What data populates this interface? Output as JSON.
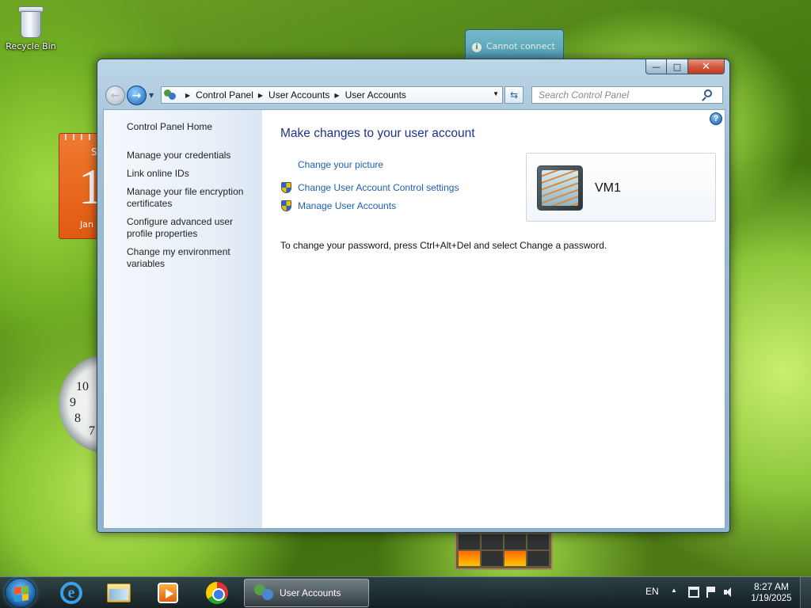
{
  "desktop": {
    "recycle_bin_label": "Recycle Bin",
    "calendar_gadget": {
      "day_abbrev": "S",
      "date_num": "1",
      "month_abbrev": "Jan"
    },
    "clock_gadget": {
      "numerals": [
        "10",
        "9",
        "8",
        "7"
      ]
    },
    "notification": "Cannot connect"
  },
  "window": {
    "controls": {
      "minimize": "—",
      "maximize": "□",
      "close": "✕"
    },
    "address": {
      "crumbs": [
        "Control Panel",
        "User Accounts",
        "User Accounts"
      ],
      "separator": "▶",
      "dropdown": "▼"
    },
    "nav": {
      "back": "←",
      "forward": "→",
      "recent": "▼",
      "refresh": "⇆"
    },
    "search": {
      "placeholder": "Search Control Panel"
    },
    "help_glyph": "?",
    "left_pane": {
      "home": "Control Panel Home",
      "tasks": [
        "Manage your credentials",
        "Link online IDs",
        "Manage your file encryption certificates",
        "Configure advanced user profile properties",
        "Change my environment variables"
      ]
    },
    "main": {
      "title": "Make changes to your user account",
      "links": {
        "change_picture": "Change your picture",
        "uac_settings": "Change User Account Control settings",
        "manage_accounts": "Manage User Accounts"
      },
      "info": "To change your password, press Ctrl+Alt+Del and select Change a password."
    },
    "user": {
      "name": "VM1"
    }
  },
  "taskbar": {
    "active_task": "User Accounts",
    "tray": {
      "language": "EN",
      "show_hidden": "▲",
      "time": "8:27 AM",
      "date": "1/19/2025"
    }
  }
}
